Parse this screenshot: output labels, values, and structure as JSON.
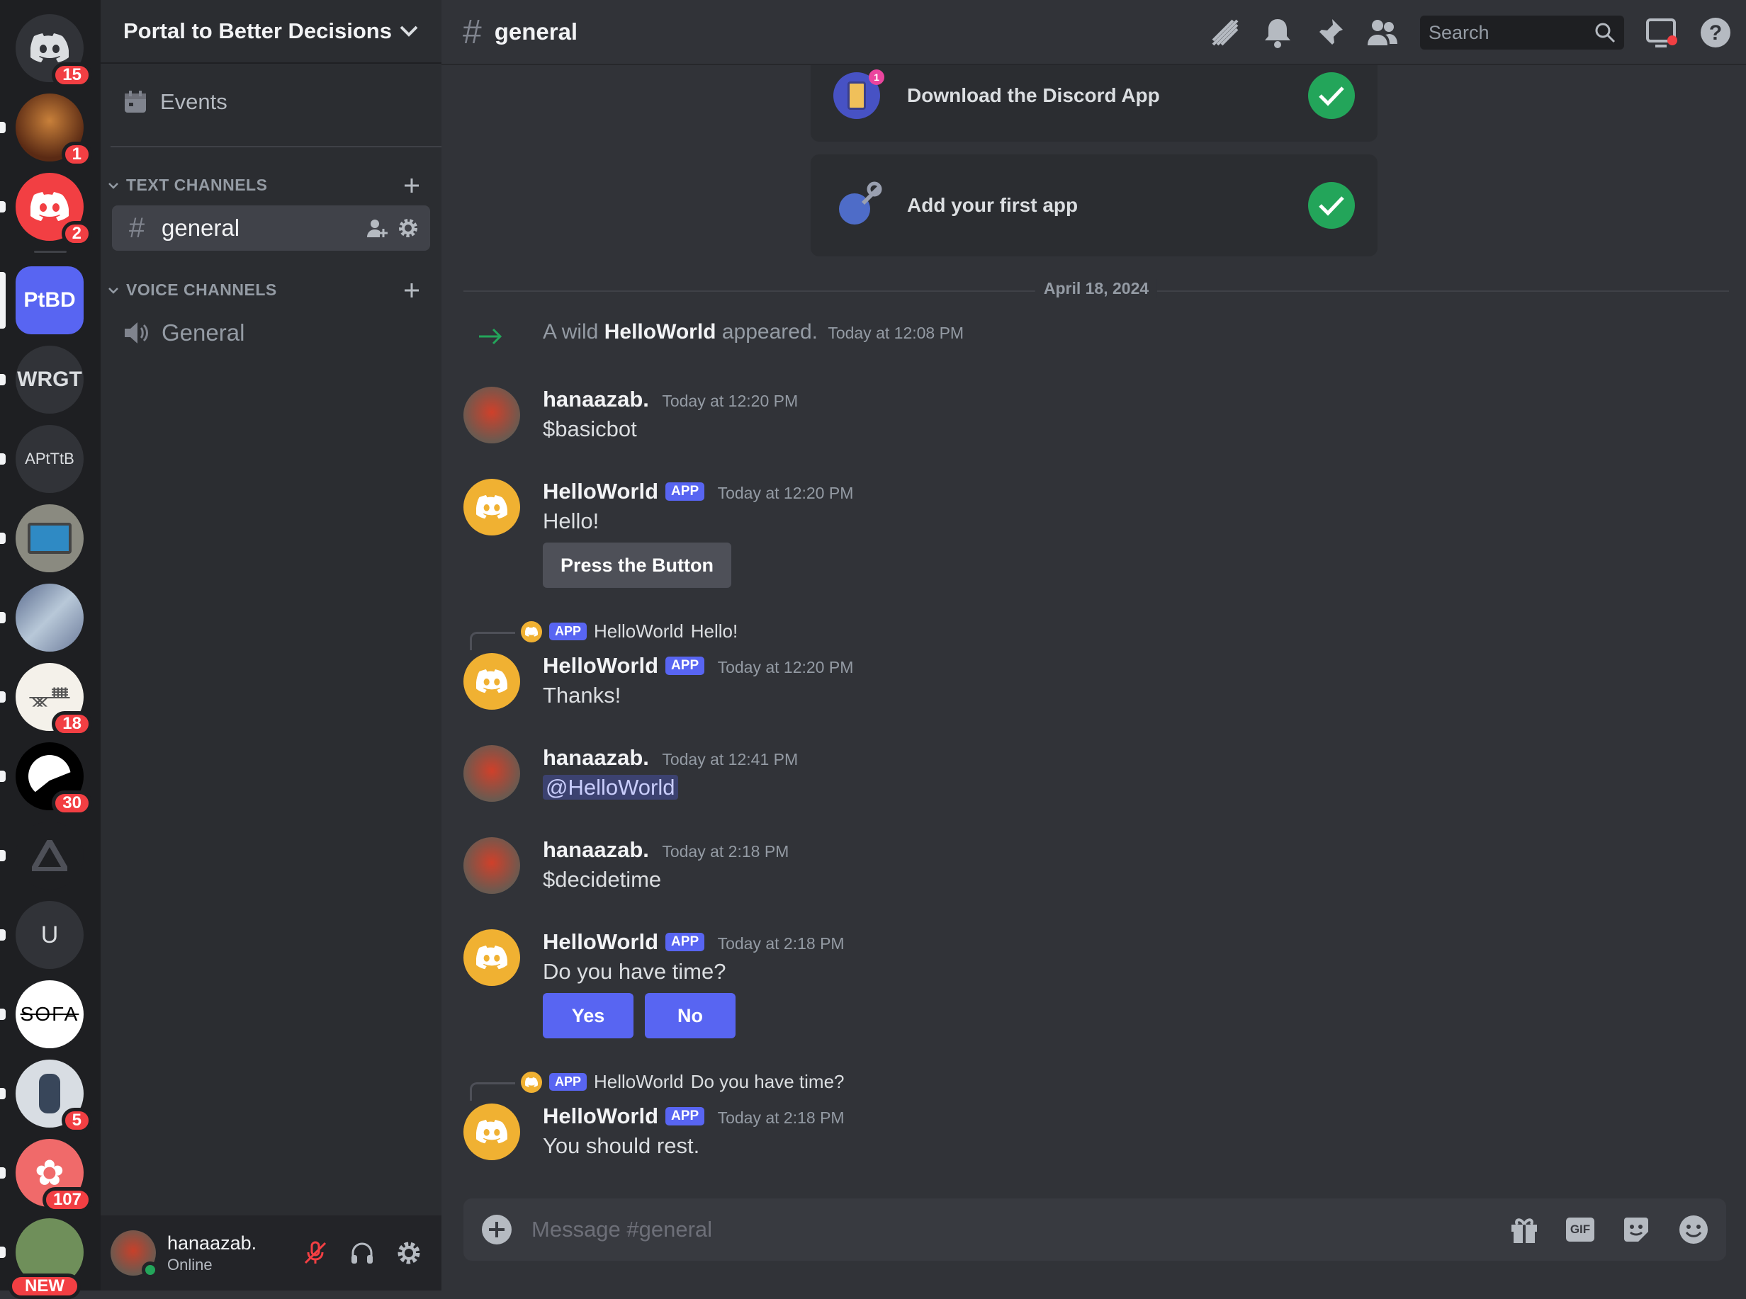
{
  "rail": {
    "servers": [
      {
        "id": "home",
        "label": "",
        "badge": "15"
      },
      {
        "id": "s1",
        "label": "",
        "badge": "1"
      },
      {
        "id": "s2",
        "label": "",
        "badge": "2"
      },
      {
        "id": "ptbd",
        "label": "PtBD",
        "badge": ""
      },
      {
        "id": "wrgt",
        "label": "WRGT",
        "badge": ""
      },
      {
        "id": "aptb",
        "label": "APtTtB",
        "badge": ""
      },
      {
        "id": "s6",
        "label": "",
        "badge": ""
      },
      {
        "id": "s7",
        "label": "",
        "badge": ""
      },
      {
        "id": "s8",
        "label": "",
        "badge": "18"
      },
      {
        "id": "s9",
        "label": "",
        "badge": "30"
      },
      {
        "id": "s10",
        "label": "",
        "badge": ""
      },
      {
        "id": "u",
        "label": "U",
        "badge": ""
      },
      {
        "id": "sofa",
        "label": "SOFA",
        "badge": ""
      },
      {
        "id": "s13",
        "label": "",
        "badge": "5"
      },
      {
        "id": "s14",
        "label": "",
        "badge": "107"
      },
      {
        "id": "s15",
        "label": "",
        "badge": "NEW"
      }
    ]
  },
  "sidebar": {
    "server_name": "Portal to Better Decisions",
    "events_label": "Events",
    "text_category": "TEXT CHANNELS",
    "voice_category": "VOICE CHANNELS",
    "text_channel": "general",
    "voice_channel": "General"
  },
  "user": {
    "name": "hanaazab.",
    "status": "Online"
  },
  "header": {
    "channel": "general",
    "search_placeholder": "Search"
  },
  "onboarding": [
    {
      "label": "Download the Discord App",
      "badge": "1"
    },
    {
      "label": "Add your first app"
    }
  ],
  "date_divider": "April 18, 2024",
  "join": {
    "prefix": "A wild",
    "name": "HelloWorld",
    "suffix": "appeared.",
    "time": "Today at 12:08 PM"
  },
  "messages": [
    {
      "author": "hanaazab.",
      "time": "Today at 12:20 PM",
      "text": "$basicbot"
    },
    {
      "author": "HelloWorld",
      "tag": "APP",
      "time": "Today at 12:20 PM",
      "text": "Hello!",
      "button": "Press the Button"
    },
    {
      "reply_tag": "APP",
      "reply_name": "HelloWorld",
      "reply_text": "Hello!",
      "author": "HelloWorld",
      "tag": "APP",
      "time": "Today at 12:20 PM",
      "text": "Thanks!"
    },
    {
      "author": "hanaazab.",
      "time": "Today at 12:41 PM",
      "text": "@HelloWorld"
    },
    {
      "author": "hanaazab.",
      "time": "Today at 2:18 PM",
      "text": "$decidetime"
    },
    {
      "author": "HelloWorld",
      "tag": "APP",
      "time": "Today at 2:18 PM",
      "text": "Do you have time?",
      "yes": "Yes",
      "no": "No"
    },
    {
      "reply_tag": "APP",
      "reply_name": "HelloWorld",
      "reply_text": "Do you have time?",
      "author": "HelloWorld",
      "tag": "APP",
      "time": "Today at 2:18 PM",
      "text": "You should rest."
    }
  ],
  "composer": {
    "placeholder": "Message #general",
    "gif": "GIF"
  },
  "colors": {
    "blurple": "#5865f2",
    "green": "#23a55a",
    "red": "#f23f43",
    "bot": "#f0b132"
  }
}
